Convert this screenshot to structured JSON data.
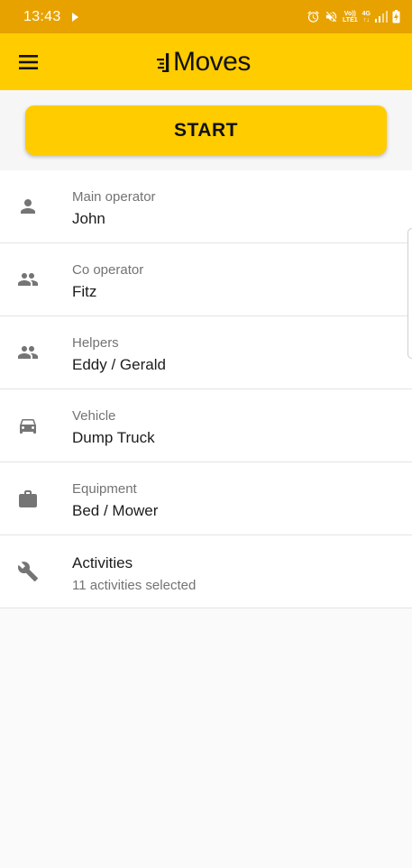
{
  "status_bar": {
    "time": "13:43",
    "network_top": "Vo))",
    "network_bottom": "LTE1",
    "data_top": "4G",
    "data_bottom": "↑↓"
  },
  "app_bar": {
    "brand": "Moves",
    "menu_icon": "hamburger-menu-icon"
  },
  "colors": {
    "status_bar": "#e8a200",
    "accent": "#ffcc00",
    "icon": "#757575"
  },
  "start_button": {
    "label": "START"
  },
  "items": [
    {
      "label": "Main operator",
      "value": "John",
      "icon": "person-icon"
    },
    {
      "label": "Co operator",
      "value": "Fitz",
      "icon": "people-icon"
    },
    {
      "label": "Helpers",
      "value": "Eddy / Gerald",
      "icon": "people-icon"
    },
    {
      "label": "Vehicle",
      "value": "Dump Truck",
      "icon": "car-icon"
    },
    {
      "label": "Equipment",
      "value": "Bed / Mower",
      "icon": "briefcase-icon"
    }
  ],
  "activities": {
    "title": "Activities",
    "subtitle": "11 activities selected",
    "icon": "wrench-icon"
  }
}
